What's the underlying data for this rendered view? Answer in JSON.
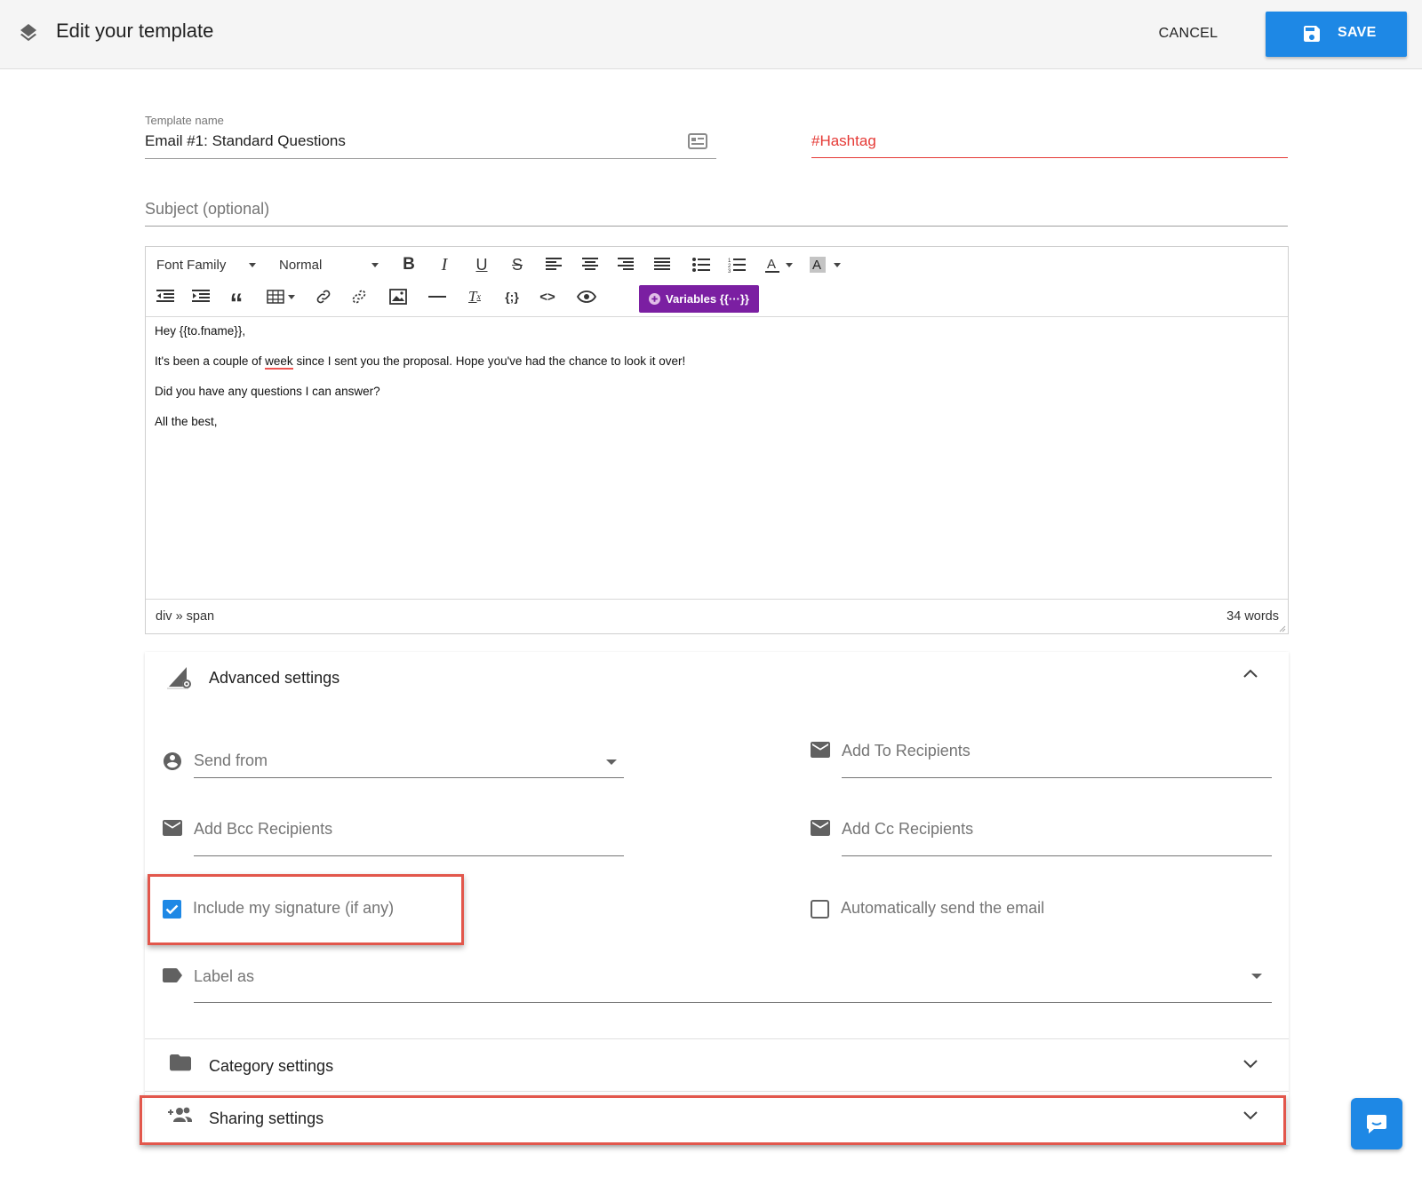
{
  "header": {
    "title": "Edit your template",
    "cancel_label": "CANCEL",
    "save_label": "SAVE"
  },
  "template_name": {
    "label": "Template name",
    "value": "Email #1: Standard Questions"
  },
  "hashtag": {
    "placeholder": "#Hashtag"
  },
  "subject": {
    "placeholder": "Subject (optional)"
  },
  "toolbar": {
    "font_family": "Font Family",
    "font_size": "Normal",
    "variables_label": "Variables {{···}}"
  },
  "editor": {
    "lines": [
      "Hey {{to.fname}},",
      "It's been a couple of ",
      "Did you have any questions I can answer?",
      "All the best,"
    ],
    "misspelled_word": "week",
    "line2_rest": " since I sent you the proposal. Hope you've had the chance to look it over!",
    "path": "div » span",
    "word_count": "34 words"
  },
  "advanced": {
    "title": "Advanced settings",
    "send_from": "Send from",
    "add_to": "Add To Recipients",
    "add_bcc": "Add Bcc Recipients",
    "add_cc": "Add Cc Recipients",
    "include_signature": "Include my signature (if any)",
    "include_signature_checked": true,
    "auto_send": "Automatically send the email",
    "auto_send_checked": false,
    "label_as": "Label as"
  },
  "category": {
    "title": "Category settings"
  },
  "sharing": {
    "title": "Sharing settings"
  },
  "colors": {
    "primary": "#1e88e5",
    "variables_purple": "#7b1fa2",
    "hashtag_red": "#e53935",
    "highlight_red": "#e2574c"
  }
}
